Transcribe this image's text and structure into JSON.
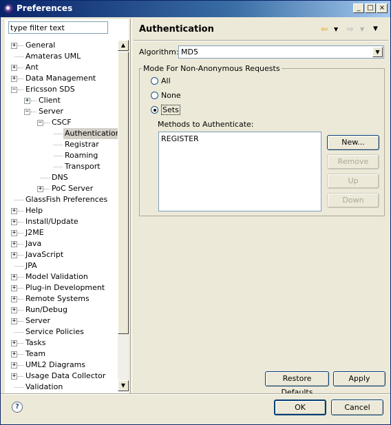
{
  "window": {
    "title": "Preferences",
    "minimize": "_",
    "maximize": "□",
    "close": "×"
  },
  "filter": {
    "placeholder": "type filter text",
    "value": "type filter text"
  },
  "tree": [
    {
      "label": "General",
      "level": 0,
      "expander": "+"
    },
    {
      "label": "Amateras UML",
      "level": 0,
      "expander": ""
    },
    {
      "label": "Ant",
      "level": 0,
      "expander": "+"
    },
    {
      "label": "Data Management",
      "level": 0,
      "expander": "+"
    },
    {
      "label": "Ericsson SDS",
      "level": 0,
      "expander": "−"
    },
    {
      "label": "Client",
      "level": 1,
      "expander": "+"
    },
    {
      "label": "Server",
      "level": 1,
      "expander": "−"
    },
    {
      "label": "CSCF",
      "level": 2,
      "expander": "−"
    },
    {
      "label": "Authentication",
      "level": 3,
      "expander": "",
      "selected": true
    },
    {
      "label": "Registrar",
      "level": 3,
      "expander": ""
    },
    {
      "label": "Roaming",
      "level": 3,
      "expander": ""
    },
    {
      "label": "Transport",
      "level": 3,
      "expander": ""
    },
    {
      "label": "DNS",
      "level": 2,
      "expander": ""
    },
    {
      "label": "PoC Server",
      "level": 2,
      "expander": "+"
    },
    {
      "label": "GlassFish Preferences",
      "level": 0,
      "expander": ""
    },
    {
      "label": "Help",
      "level": 0,
      "expander": "+"
    },
    {
      "label": "Install/Update",
      "level": 0,
      "expander": "+"
    },
    {
      "label": "J2ME",
      "level": 0,
      "expander": "+"
    },
    {
      "label": "Java",
      "level": 0,
      "expander": "+"
    },
    {
      "label": "JavaScript",
      "level": 0,
      "expander": "+"
    },
    {
      "label": "JPA",
      "level": 0,
      "expander": ""
    },
    {
      "label": "Model Validation",
      "level": 0,
      "expander": "+"
    },
    {
      "label": "Plug-in Development",
      "level": 0,
      "expander": "+"
    },
    {
      "label": "Remote Systems",
      "level": 0,
      "expander": "+"
    },
    {
      "label": "Run/Debug",
      "level": 0,
      "expander": "+"
    },
    {
      "label": "Server",
      "level": 0,
      "expander": "+"
    },
    {
      "label": "Service Policies",
      "level": 0,
      "expander": ""
    },
    {
      "label": "Tasks",
      "level": 0,
      "expander": "+"
    },
    {
      "label": "Team",
      "level": 0,
      "expander": "+"
    },
    {
      "label": "UML2 Diagrams",
      "level": 0,
      "expander": "+"
    },
    {
      "label": "Usage Data Collector",
      "level": 0,
      "expander": "+"
    },
    {
      "label": "Validation",
      "level": 0,
      "expander": ""
    }
  ],
  "page": {
    "title": "Authentication",
    "algorithm_label": "Algorithm:",
    "algorithm_value": "MD5",
    "group_title": "Mode For Non-Anonymous Requests",
    "radios": [
      {
        "label": "All",
        "checked": false
      },
      {
        "label": "None",
        "checked": false
      },
      {
        "label": "Sets",
        "checked": true
      }
    ],
    "methods_label": "Methods to Authenticate:",
    "methods": [
      "REGISTER"
    ],
    "buttons": {
      "new": "New...",
      "remove": "Remove",
      "up": "Up",
      "down": "Down"
    },
    "restore_defaults": "Restore Defaults",
    "apply": "Apply"
  },
  "footer": {
    "ok": "OK",
    "cancel": "Cancel",
    "help": "?"
  },
  "colors": {
    "titlebar_start": "#0a246a",
    "selection": "#d4d0c8",
    "dialog_bg": "#ece9d8"
  }
}
